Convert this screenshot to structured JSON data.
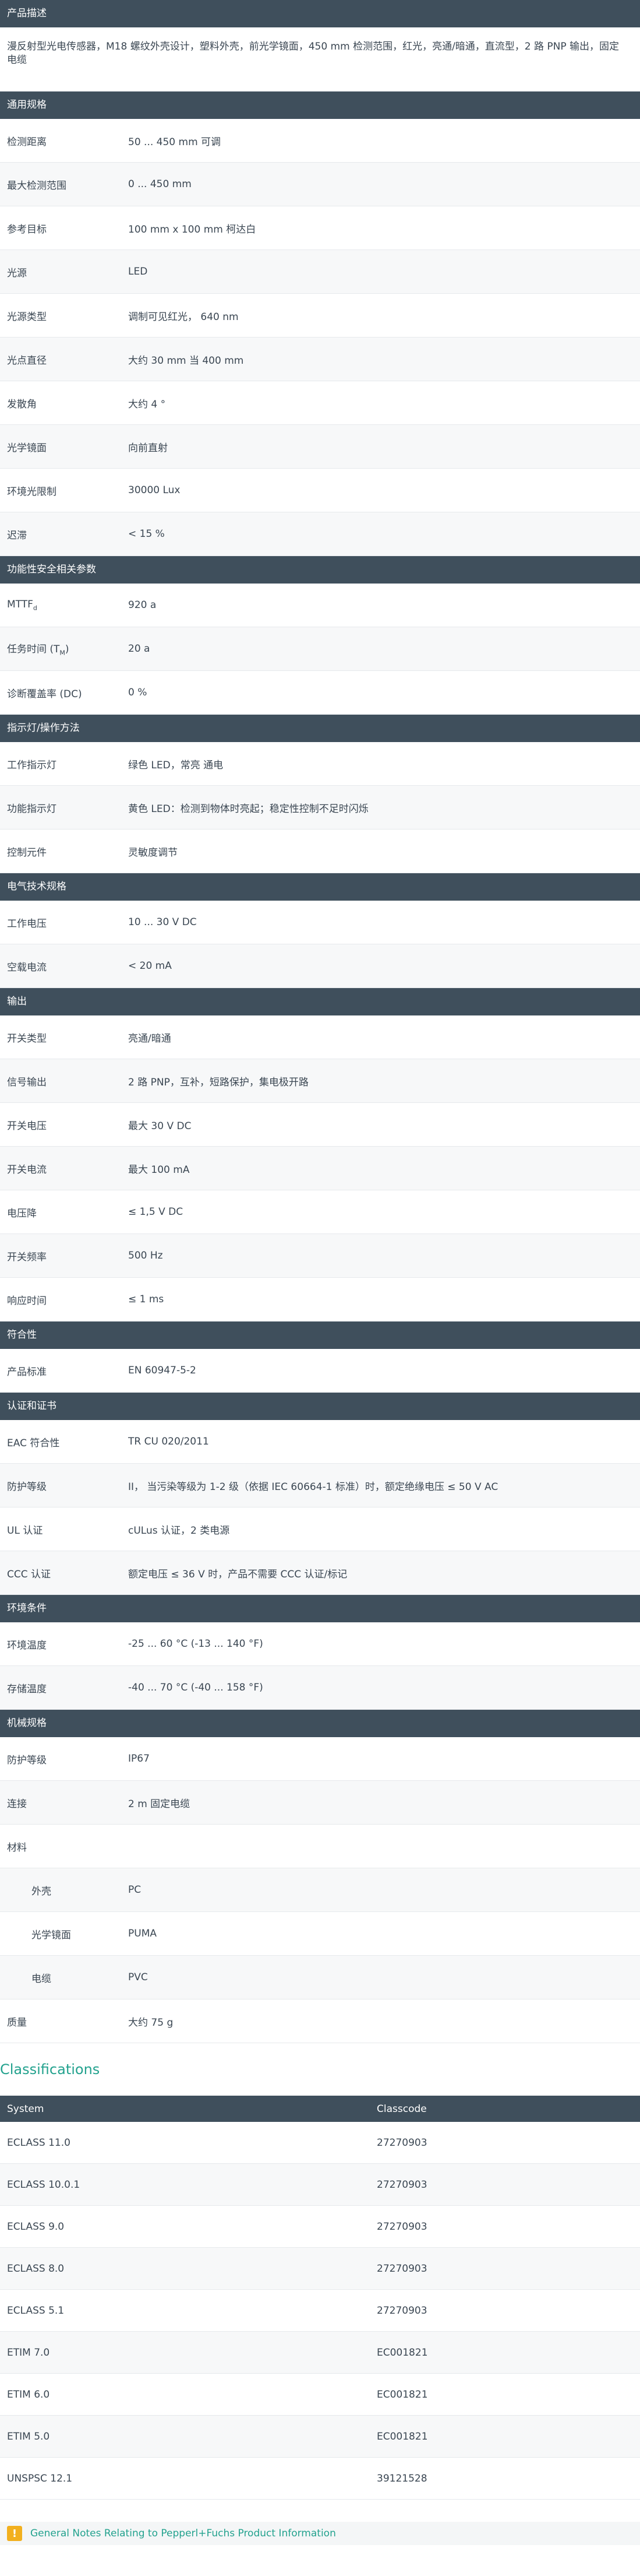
{
  "s_product": {
    "title": "产品描述",
    "desc": "漫反射型光电传感器，M18 螺纹外壳设计，塑料外壳，前光学镜面，450 mm 检测范围，红光，亮通/暗通，直流型，2 路 PNP 输出，固定电缆"
  },
  "s_general": {
    "title": "通用规格",
    "rows": [
      {
        "label": "检测距离",
        "value": "50 ... 450 mm 可调"
      },
      {
        "label": "最大检测范围",
        "value": "0 ... 450 mm"
      },
      {
        "label": "参考目标",
        "value": "100 mm x 100 mm 柯达白"
      },
      {
        "label": "光源",
        "value": "LED"
      },
      {
        "label": "光源类型",
        "value": "调制可见红光， 640 nm"
      },
      {
        "label": "光点直径",
        "value": "大约 30 mm 当 400 mm"
      },
      {
        "label": "发散角",
        "value": "大约 4 °"
      },
      {
        "label": "光学镜面",
        "value": "向前直射"
      },
      {
        "label": "环境光限制",
        "value": "30000 Lux"
      },
      {
        "label": "迟滞",
        "value": "< 15 %"
      }
    ]
  },
  "s_safety": {
    "title": "功能性安全相关参数",
    "mttf_label": "MTTF",
    "mttf_sub": "d",
    "mttf_value": "920 a",
    "tm_label": "任务时间 (T",
    "tm_sub": "M",
    "tm_close": ")",
    "tm_value": "20 a",
    "dc_label": "诊断覆盖率 (DC)",
    "dc_value": "0 %"
  },
  "s_indicators": {
    "title": "指示灯/操作方法",
    "rows": [
      {
        "label": "工作指示灯",
        "value": "绿色 LED，常亮 通电"
      },
      {
        "label": "功能指示灯",
        "value": "黄色 LED：检测到物体时亮起；稳定性控制不足时闪烁"
      },
      {
        "label": "控制元件",
        "value": "灵敏度调节"
      }
    ]
  },
  "s_electrical": {
    "title": "电气技术规格",
    "rows": [
      {
        "label": "工作电压",
        "value": "10 ... 30 V DC"
      },
      {
        "label": "空载电流",
        "value": "< 20 mA"
      }
    ]
  },
  "s_output": {
    "title": "输出",
    "rows": [
      {
        "label": "开关类型",
        "value": "亮通/暗通"
      },
      {
        "label": "信号输出",
        "value": "2 路 PNP，互补，短路保护，集电极开路"
      },
      {
        "label": "开关电压",
        "value": "最大 30 V DC"
      },
      {
        "label": "开关电流",
        "value": "最大 100 mA"
      },
      {
        "label": "电压降",
        "value": "≤ 1,5 V DC"
      },
      {
        "label": "开关频率",
        "value": "500 Hz"
      },
      {
        "label": "响应时间",
        "value": "≤ 1 ms"
      }
    ]
  },
  "s_conformity": {
    "title": "符合性",
    "rows": [
      {
        "label": "产品标准",
        "value": "EN 60947-5-2"
      }
    ]
  },
  "s_approvals": {
    "title": "认证和证书",
    "rows": [
      {
        "label": "EAC 符合性",
        "value": "TR CU 020/2011"
      },
      {
        "label": "防护等级",
        "value": "II， 当污染等级为 1-2 级（依据 IEC 60664-1 标准）时，额定绝缘电压 ≤ 50 V AC"
      },
      {
        "label": "UL 认证",
        "value": "cULus 认证，2 类电源"
      },
      {
        "label": "CCC 认证",
        "value": "额定电压 ≤ 36 V 时，产品不需要 CCC 认证/标记"
      }
    ]
  },
  "s_ambient": {
    "title": "环境条件",
    "rows": [
      {
        "label": "环境温度",
        "value": "-25 ... 60 °C (-13 ... 140 °F)"
      },
      {
        "label": "存储温度",
        "value": "-40 ... 70 °C (-40 ... 158 °F)"
      }
    ]
  },
  "s_mechanical": {
    "title": "机械规格",
    "protection_label": "防护等级",
    "protection_value": "IP67",
    "connection_label": "连接",
    "connection_value": "2 m 固定电缆",
    "material_label": "材料",
    "housing_label": "外壳",
    "housing_value": "PC",
    "optical_label": "光学镜面",
    "optical_value": "PUMA",
    "cable_label": "电缆",
    "cable_value": "PVC",
    "mass_label": "质量",
    "mass_value": "大约 75 g"
  },
  "classifications": {
    "title": "Classifications",
    "col_system": "System",
    "col_classcode": "Classcode",
    "rows": [
      {
        "system": "ECLASS 11.0",
        "code": "27270903"
      },
      {
        "system": "ECLASS 10.0.1",
        "code": "27270903"
      },
      {
        "system": "ECLASS 9.0",
        "code": "27270903"
      },
      {
        "system": "ECLASS 8.0",
        "code": "27270903"
      },
      {
        "system": "ECLASS 5.1",
        "code": "27270903"
      },
      {
        "system": "ETIM 7.0",
        "code": "EC001821"
      },
      {
        "system": "ETIM 6.0",
        "code": "EC001821"
      },
      {
        "system": "ETIM 5.0",
        "code": "EC001821"
      },
      {
        "system": "UNSPSC 12.1",
        "code": "39121528"
      }
    ]
  },
  "notes": {
    "icon": "warning-icon",
    "text": "General Notes Relating to Pepperl+Fuchs Product Information"
  }
}
